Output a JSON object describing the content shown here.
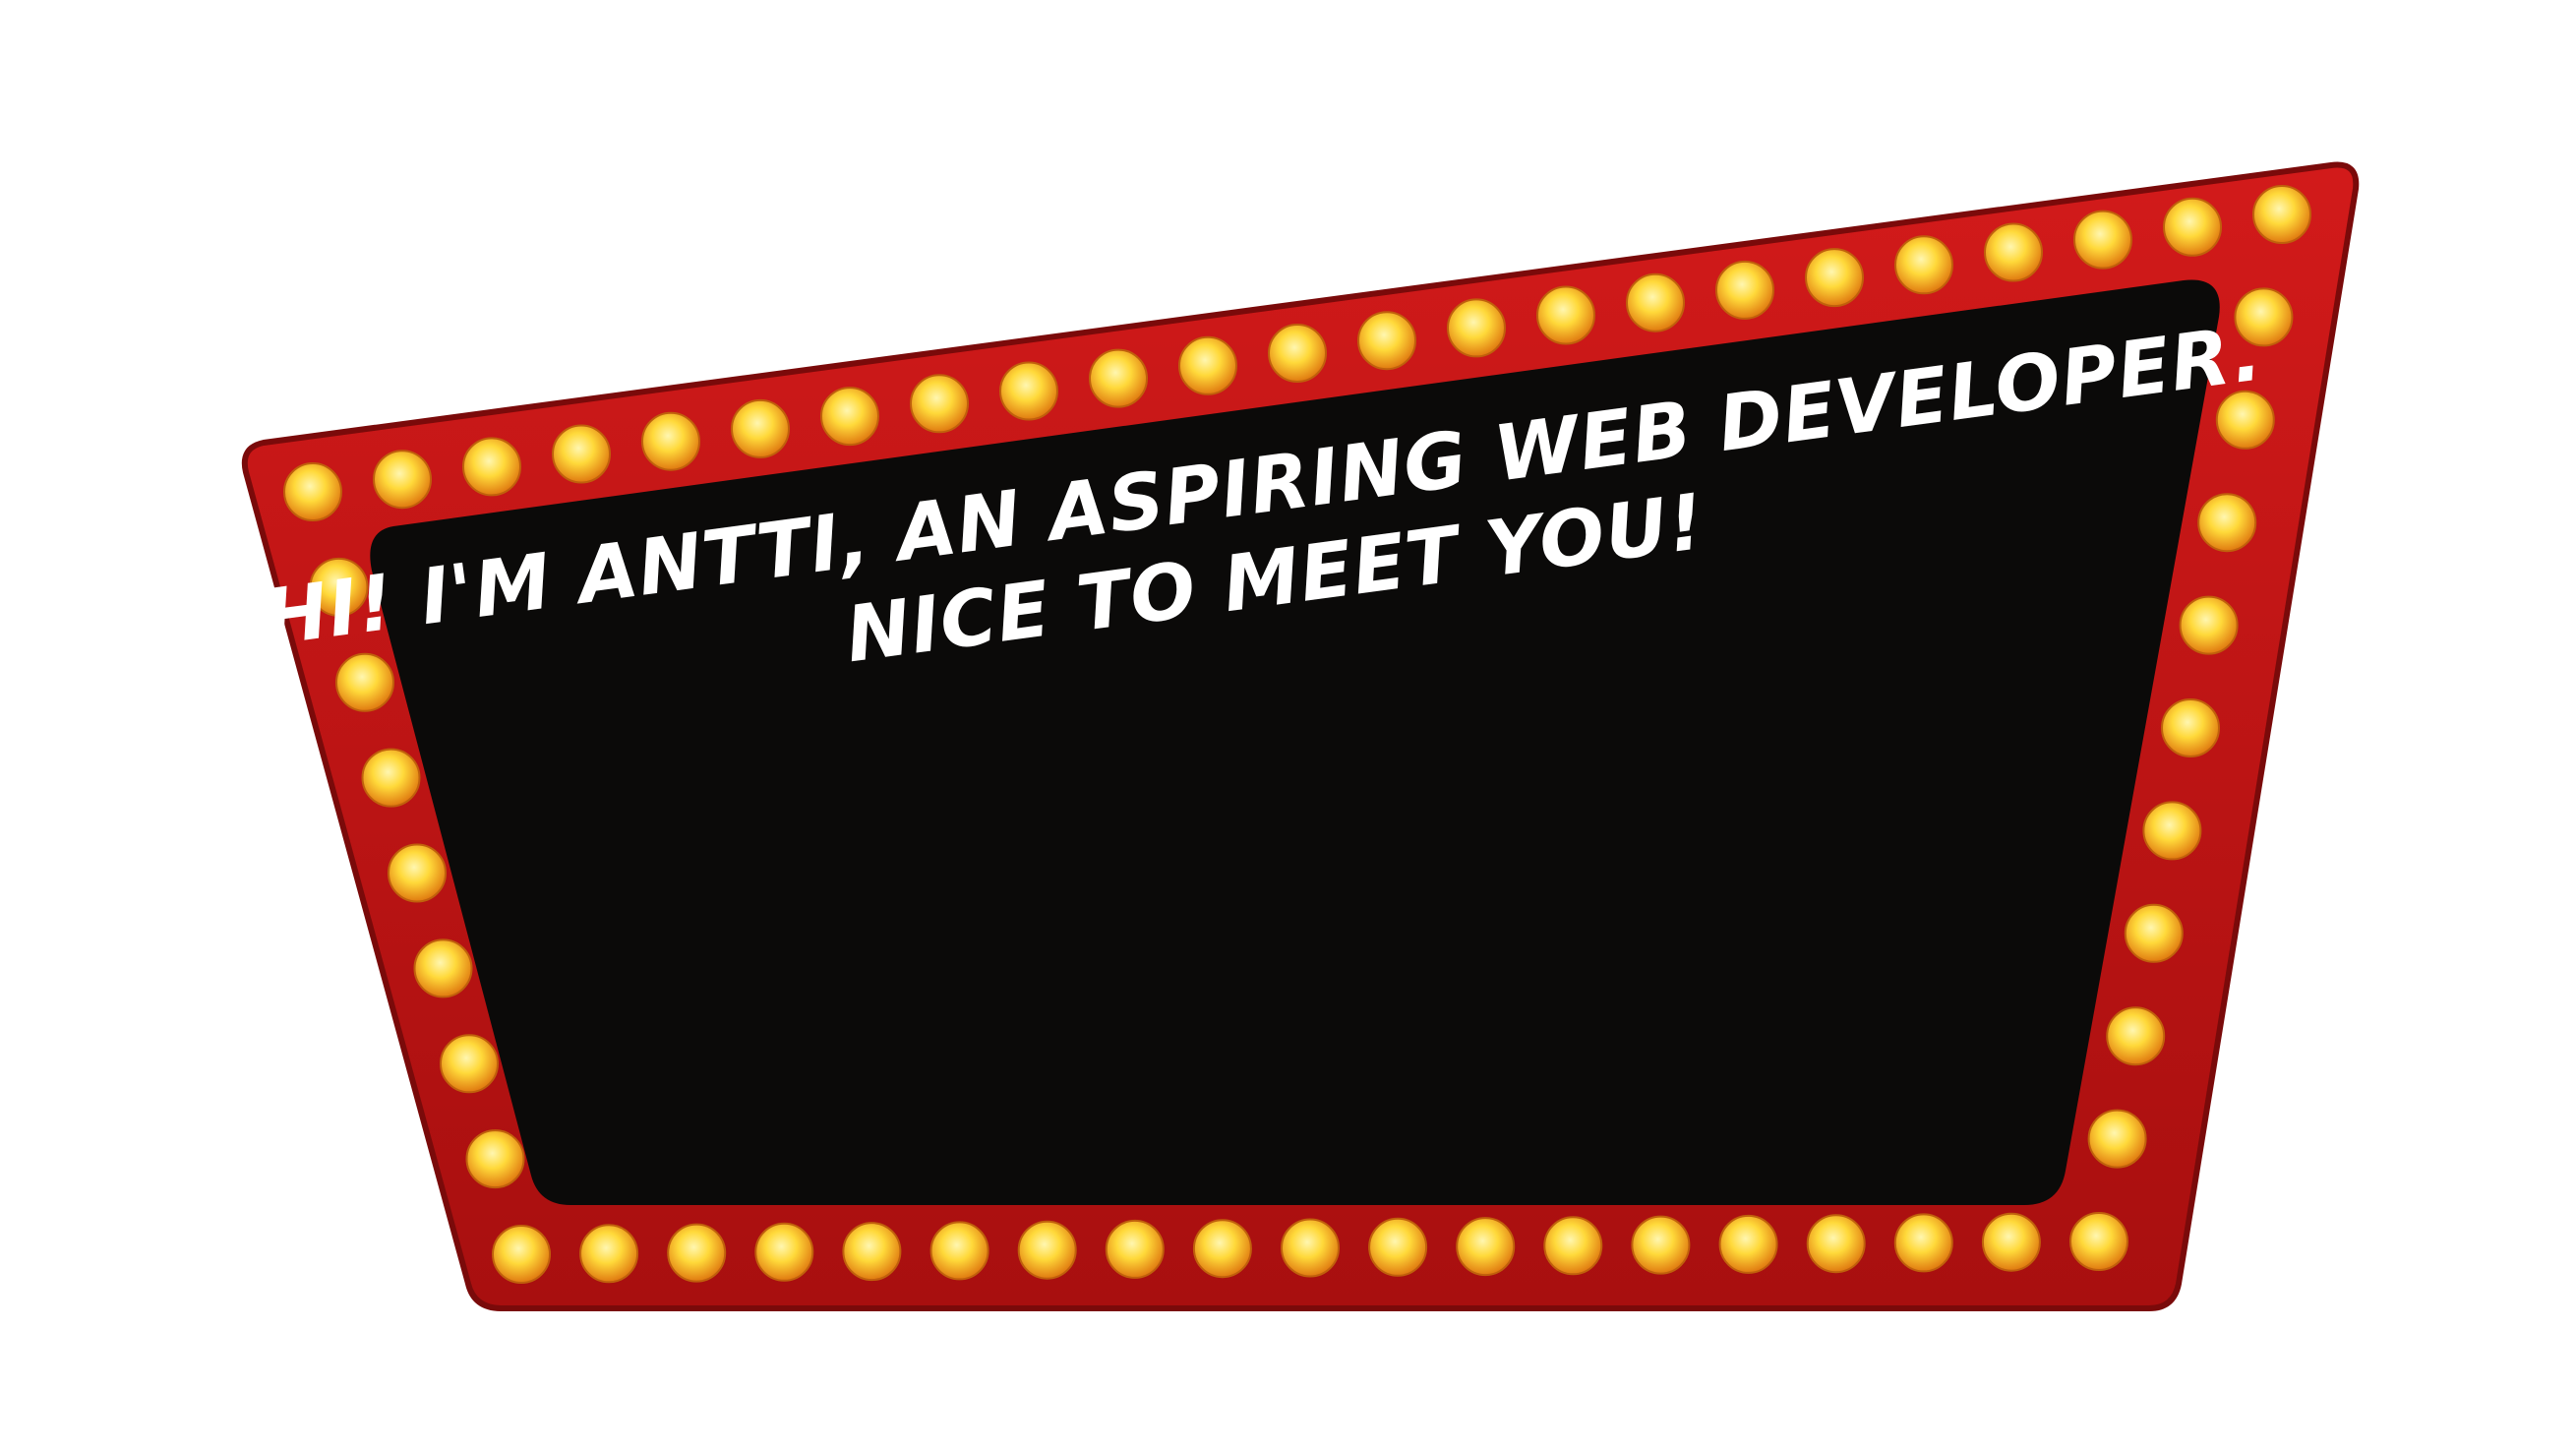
{
  "sign": {
    "line1": "HI! I'M ANTTI, AN ASPIRING WEB DEVELOPER.",
    "line2": "NICE TO MEET YOU!"
  },
  "colors": {
    "frame": "#c01414",
    "frame_dark": "#7a0a0a",
    "screen": "#0b0a09",
    "bulb_core": "#ffd93a",
    "bulb_edge": "#e07a10",
    "text": "#ffffff",
    "background": "#ffffff"
  }
}
